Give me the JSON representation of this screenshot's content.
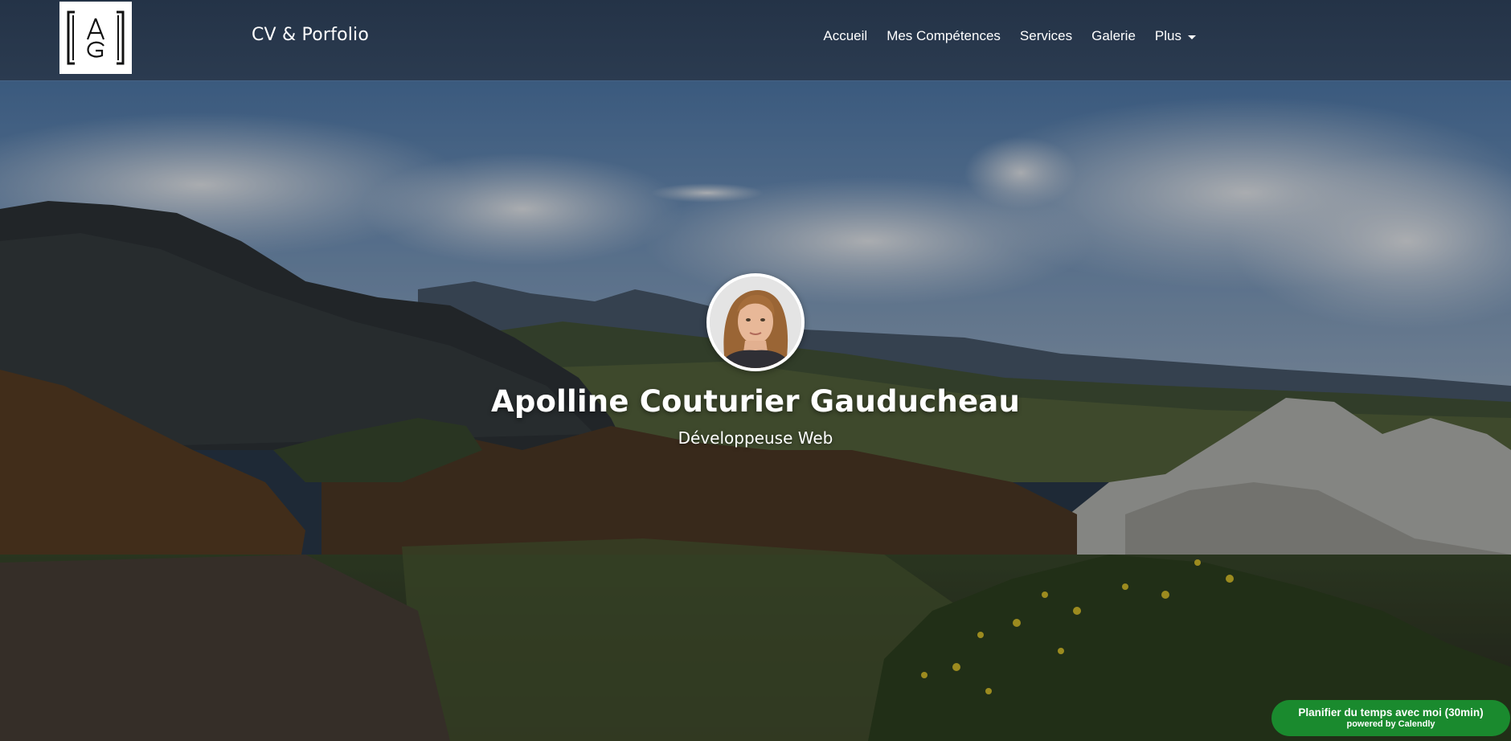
{
  "navbar": {
    "brand": "CV & Porfolio",
    "logo_icon": "ag-monogram-logo-icon",
    "links": [
      {
        "label": "Accueil"
      },
      {
        "label": "Mes Compétences"
      },
      {
        "label": "Services"
      },
      {
        "label": "Galerie"
      },
      {
        "label": "Plus",
        "has_dropdown": true
      }
    ]
  },
  "hero": {
    "name": "Apolline Couturier Gauducheau",
    "role": "Développeuse Web",
    "avatar_icon": "profile-photo"
  },
  "calendly": {
    "label": "Planifier du temps avec moi (30min)",
    "powered_by": "powered by Calendly",
    "color": "#1a8a2e"
  },
  "colors": {
    "navbar": "#2b3b50",
    "text": "#ffffff"
  }
}
